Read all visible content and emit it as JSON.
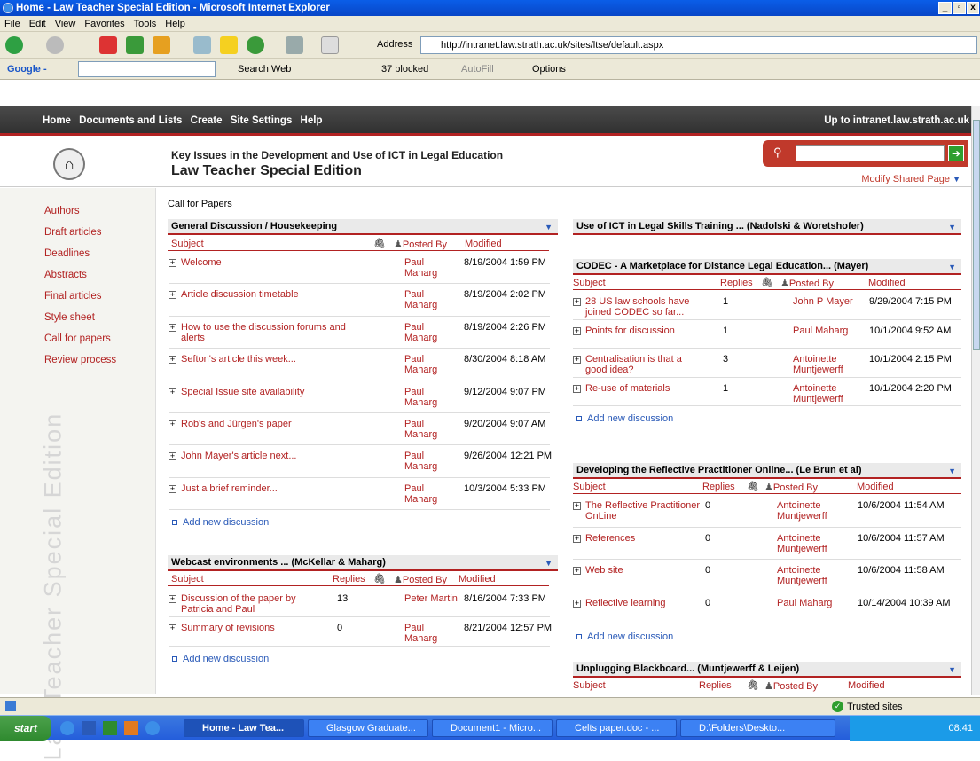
{
  "window": {
    "title": "Home - Law Teacher Special Edition - Microsoft Internet Explorer"
  },
  "menu": [
    "File",
    "Edit",
    "View",
    "Favorites",
    "Tools",
    "Help"
  ],
  "address": {
    "label": "Address",
    "url": "http://intranet.law.strath.ac.uk/sites/ltse/default.aspx"
  },
  "google": {
    "label": "Google -",
    "search_web": "Search Web",
    "blocked": "37 blocked",
    "autofill": "AutoFill",
    "options": "Options"
  },
  "nav": {
    "links": [
      "Home",
      "Documents and Lists",
      "Create",
      "Site Settings",
      "Help"
    ],
    "up": "Up to intranet.law.strath.ac.uk"
  },
  "banner": {
    "subtitle": "Key Issues in the Development and Use of ICT in Legal Education",
    "title": "Law Teacher Special Edition",
    "modify": "Modify Shared Page"
  },
  "sidebar": {
    "items": [
      "Authors",
      "Draft articles",
      "Deadlines",
      "Abstracts",
      "Final articles",
      "Style sheet",
      "Call for papers",
      "Review process"
    ],
    "watermark": "Law Teacher Special Edition"
  },
  "section_title": "Call for Papers",
  "cols": {
    "subject": "Subject",
    "replies": "Replies",
    "posted_by": "Posted By",
    "modified": "Modified"
  },
  "add_new": "Add new discussion",
  "wp1": {
    "title": "General Discussion / Housekeeping",
    "rows": [
      {
        "s": "Welcome",
        "p": "Paul Maharg",
        "m": "8/19/2004 1:59 PM"
      },
      {
        "s": "Article discussion timetable",
        "p": "Paul Maharg",
        "m": "8/19/2004 2:02 PM"
      },
      {
        "s": "How to use the discussion forums and alerts",
        "p": "Paul Maharg",
        "m": "8/19/2004 2:26 PM"
      },
      {
        "s": "Sefton's article this week...",
        "p": "Paul Maharg",
        "m": "8/30/2004 8:18 AM"
      },
      {
        "s": "Special Issue site availability",
        "p": "Paul Maharg",
        "m": "9/12/2004 9:07 PM"
      },
      {
        "s": "Rob's and Jürgen's paper",
        "p": "Paul Maharg",
        "m": "9/20/2004 9:07 AM"
      },
      {
        "s": "John Mayer's article next...",
        "p": "Paul Maharg",
        "m": "9/26/2004 12:21 PM"
      },
      {
        "s": "Just a brief reminder...",
        "p": "Paul Maharg",
        "m": "10/3/2004 5:33 PM"
      }
    ]
  },
  "wp2": {
    "title": "Webcast environments ... (McKellar & Maharg)",
    "rows": [
      {
        "s": "Discussion of the paper by Patricia and Paul",
        "r": "13",
        "p": "Peter Martin",
        "m": "8/16/2004 7:33 PM"
      },
      {
        "s": "Summary of revisions",
        "r": "0",
        "p": "Paul Maharg",
        "m": "8/21/2004 12:57 PM"
      }
    ]
  },
  "wp3": {
    "title": "Use of ICT in Legal Skills Training ... (Nadolski & Woretshofer)"
  },
  "wp4": {
    "title": "CODEC - A Marketplace for Distance Legal Education... (Mayer)",
    "rows": [
      {
        "s": "28 US law schools have joined CODEC so far...",
        "r": "1",
        "p": "John P Mayer",
        "m": "9/29/2004 7:15 PM"
      },
      {
        "s": "Points for discussion",
        "r": "1",
        "p": "Paul Maharg",
        "m": "10/1/2004 9:52 AM"
      },
      {
        "s": "Centralisation is that a good idea?",
        "r": "3",
        "p": "Antoinette Muntjewerff",
        "m": "10/1/2004 2:15 PM"
      },
      {
        "s": "Re-use of materials",
        "r": "1",
        "p": "Antoinette Muntjewerff",
        "m": "10/1/2004 2:20 PM"
      }
    ]
  },
  "wp5": {
    "title": "Developing the Reflective Practitioner Online... (Le Brun et al)",
    "rows": [
      {
        "s": "The Reflective Practitioner OnLine",
        "r": "0",
        "p": "Antoinette Muntjewerff",
        "m": "10/6/2004 11:54 AM"
      },
      {
        "s": "References",
        "r": "0",
        "p": "Antoinette Muntjewerff",
        "m": "10/6/2004 11:57 AM"
      },
      {
        "s": "Web site",
        "r": "0",
        "p": "Antoinette Muntjewerff",
        "m": "10/6/2004 11:58 AM"
      },
      {
        "s": "Reflective learning",
        "r": "0",
        "p": "Paul Maharg",
        "m": "10/14/2004 10:39 AM"
      }
    ]
  },
  "wp6": {
    "title": "Unplugging Blackboard... (Muntjewerff & Leijen)"
  },
  "status": {
    "zone": "Trusted sites"
  },
  "taskbar": {
    "start": "start",
    "tasks": [
      "Home - Law Tea...",
      "Glasgow Graduate...",
      "Document1 - Micro...",
      "Celts paper.doc - ...",
      "D:\\Folders\\Deskto..."
    ],
    "clock": "08:41"
  }
}
